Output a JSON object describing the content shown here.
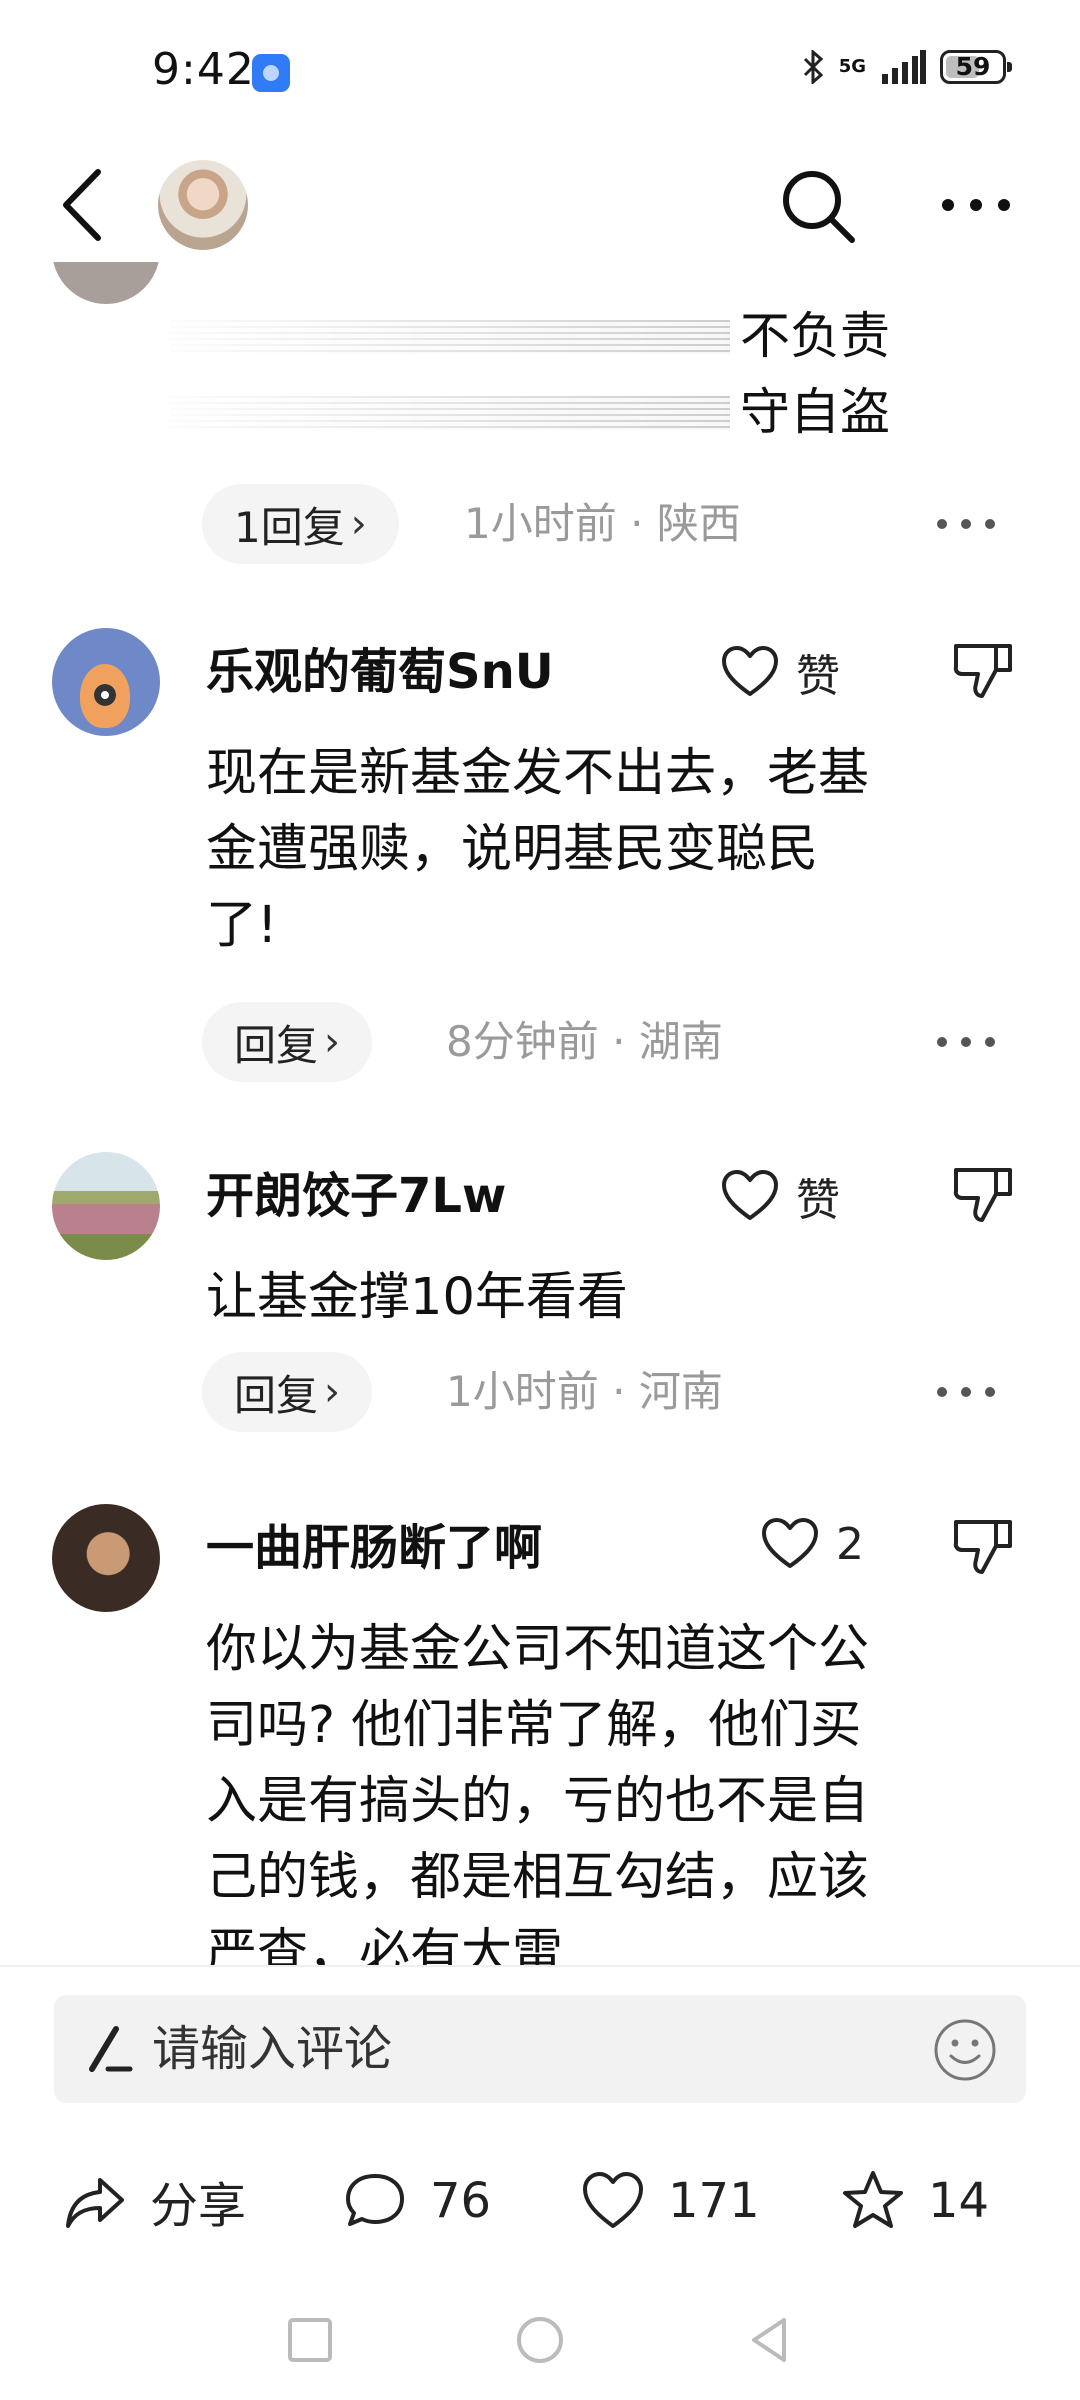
{
  "status_bar": {
    "time": "9:42",
    "network": "5G",
    "battery": "59"
  },
  "comments": [
    {
      "text_lines": [
        "不负责",
        "守自盗"
      ],
      "reply_label": "1回复",
      "time": "1小时前",
      "location": "陕西"
    },
    {
      "username": "乐观的葡萄SnU",
      "like_label": "赞",
      "text": "现在是新基金发不出去，老基\n金遭强赎，说明基民变聪民\n了!",
      "reply_label": "回复",
      "time": "8分钟前",
      "location": "湖南"
    },
    {
      "username": "开朗饺子7Lw",
      "like_label": "赞",
      "text": "让基金撑10年看看",
      "reply_label": "回复",
      "time": "1小时前",
      "location": "河南"
    },
    {
      "username": "一曲肝肠断了啊",
      "like_label": "2",
      "text": "你以为基金公司不知道这个公\n司吗? 他们非常了解，他们买\n入是有搞头的，亏的也不是自\n己的钱，都是相互勾结，应该\n严查，必有大雷"
    }
  ],
  "meta_separator": "·",
  "input": {
    "placeholder": "请输入评论"
  },
  "actions": {
    "share_label": "分享",
    "comments_count": "76",
    "likes_count": "171",
    "favorites_count": "14"
  },
  "icons": {
    "back": "chevron-left-icon",
    "search": "search-icon",
    "more": "more-dots-icon",
    "like": "heart-icon",
    "dislike": "thumbs-down-icon",
    "pen": "pen-icon",
    "emoji": "smiley-icon",
    "share": "share-arrow-icon",
    "comment": "comment-bubble-icon",
    "favorite": "star-icon"
  },
  "colors": {
    "accent_battery": "#bdbdbd",
    "meta_text": "#9a9a9a",
    "reply_bg": "#f4f4f4"
  }
}
